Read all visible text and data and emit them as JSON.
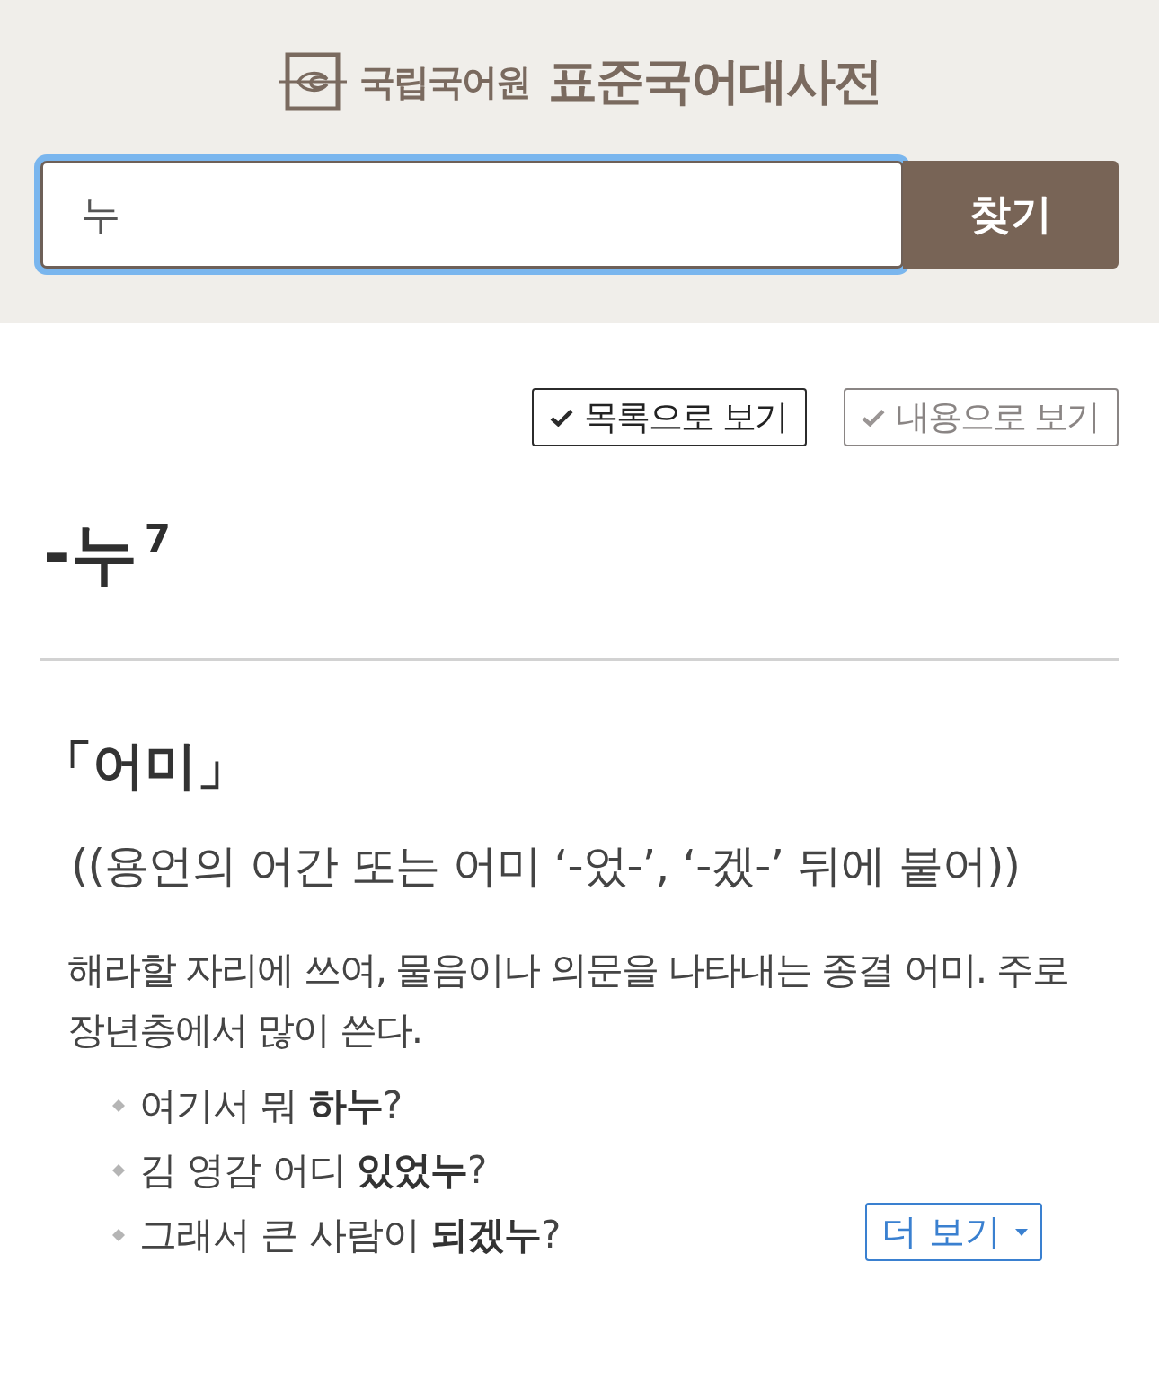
{
  "header": {
    "logo": {
      "org_name": "국립국어원",
      "dictionary_name": "표준국어대사전"
    },
    "search": {
      "value": "누",
      "focused": true
    },
    "search_button": "찾기"
  },
  "view_toggle": [
    {
      "label": "목록으로 보기",
      "selected": true
    },
    {
      "label": "내용으로 보기",
      "selected": false
    }
  ],
  "entry": {
    "headword": "-누$^{7}$",
    "part_of_speech": "「어미」",
    "grammar_note": "((용언의 어간 또는 어미 ‘-었-’, ‘-겠-’ 뒤에 붙어))",
    "definition": "해라할 자리에 쓰여, 물음이나 의문을 나타내는 종결 어미. 주로 장년층에서 많이 쓴다.",
    "examples": [
      "여기서 뭐 **하누**?",
      "김 영감 어디 **있었누**?",
      "그래서 큰 사람이 **되겠누**?"
    ],
    "more_button": "더 보기"
  }
}
